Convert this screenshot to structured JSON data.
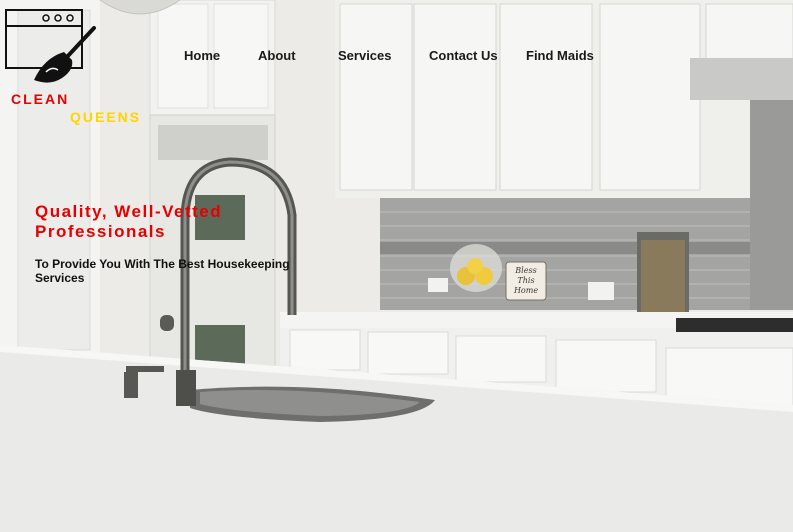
{
  "brand": {
    "name_line1": "CLEAN",
    "name_line2": "QUEENS"
  },
  "nav": {
    "items": [
      {
        "label": "Home"
      },
      {
        "label": "About"
      },
      {
        "label": "Services"
      },
      {
        "label": "Contact Us"
      },
      {
        "label": "Find Maids"
      }
    ]
  },
  "hero": {
    "headline": "Quality, Well-Vetted Professionals",
    "subheadline": "To Provide You With The Best Housekeeping Services",
    "sign_text": [
      "Bless",
      "This",
      "Home"
    ]
  },
  "colors": {
    "accent_red": "#e60000",
    "accent_yellow": "#ffd400",
    "nav_text": "#1a1a1a"
  },
  "icons": {
    "logo": "browser-window-with-broom-icon"
  }
}
